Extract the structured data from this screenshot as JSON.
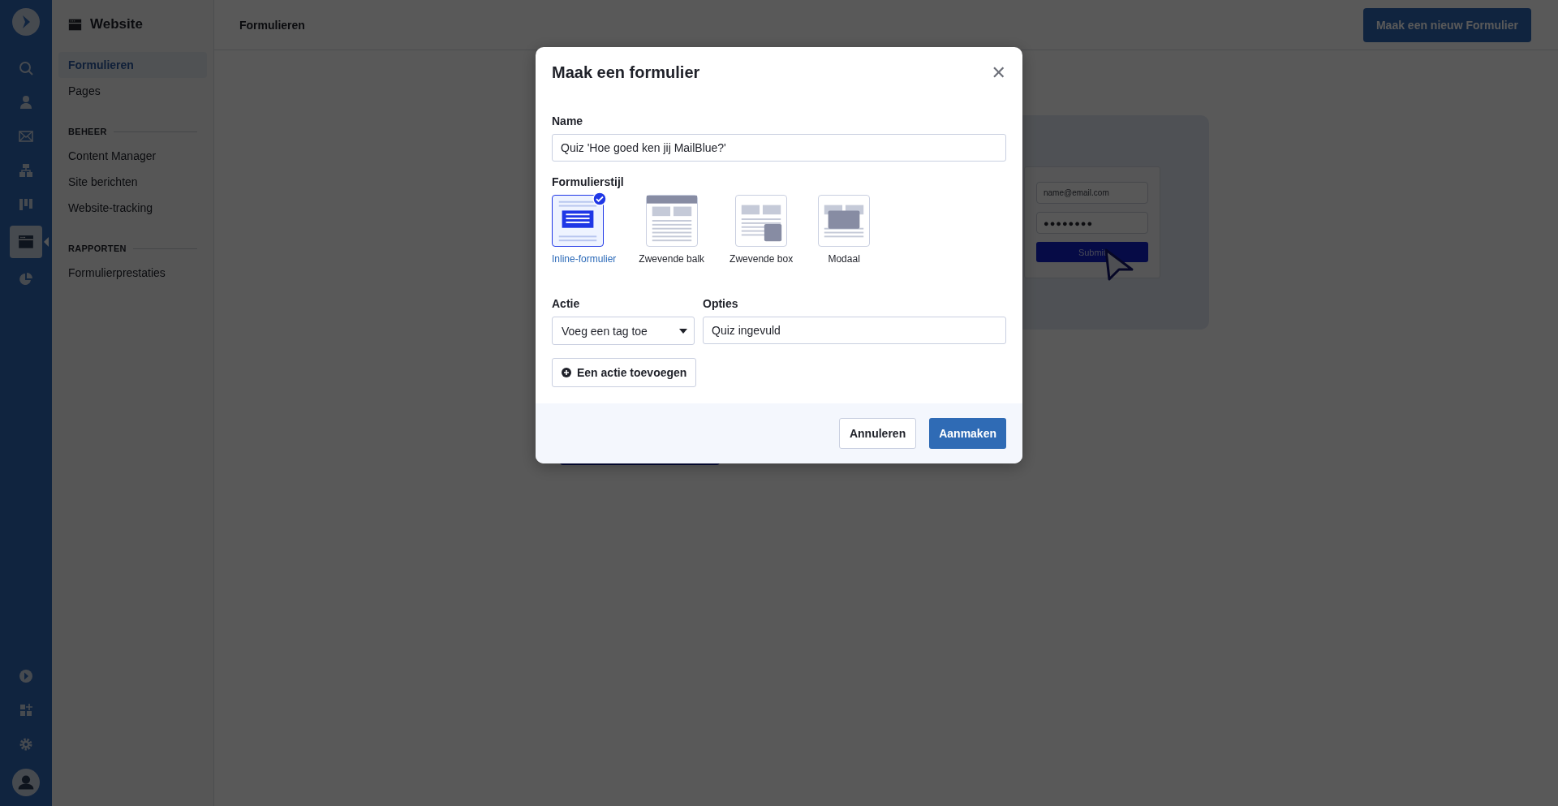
{
  "rail": {
    "items": [
      {
        "kind": "search",
        "selected": false
      },
      {
        "kind": "contacts",
        "selected": false
      },
      {
        "kind": "campaigns",
        "selected": false
      },
      {
        "kind": "automations",
        "selected": false
      },
      {
        "kind": "deals",
        "selected": false
      },
      {
        "kind": "website",
        "selected": true
      },
      {
        "kind": "reports",
        "selected": false
      }
    ],
    "bottom": [
      {
        "kind": "play"
      },
      {
        "kind": "apps"
      },
      {
        "kind": "settings"
      },
      {
        "kind": "avatar"
      }
    ]
  },
  "sidebar": {
    "title": "Website",
    "groups": [
      {
        "items": [
          {
            "label": "Formulieren",
            "selected": true
          },
          {
            "label": "Pages",
            "selected": false
          }
        ]
      },
      {
        "heading": "BEHEER",
        "items": [
          {
            "label": "Content Manager",
            "selected": false
          },
          {
            "label": "Site berichten",
            "selected": false
          },
          {
            "label": "Website-tracking",
            "selected": false
          }
        ]
      },
      {
        "heading": "RAPPORTEN",
        "items": [
          {
            "label": "Formulierprestaties",
            "selected": false
          }
        ]
      }
    ]
  },
  "header": {
    "title": "Formulieren",
    "button": "Maak een nieuw Formulier"
  },
  "illustration": {
    "email_placeholder": "name@email.com",
    "password": "●●●●●●●●",
    "submit": "Submit"
  },
  "modal": {
    "title": "Maak een formulier",
    "close": "✕",
    "name_label": "Name",
    "name_value": "Quiz 'Hoe goed ken jij MailBlue?'",
    "style_label": "Formulierstijl",
    "styles": [
      {
        "kind": "inline",
        "label": "Inline-formulier",
        "selected": true
      },
      {
        "kind": "bar",
        "label": "Zwevende balk",
        "selected": false
      },
      {
        "kind": "box",
        "label": "Zwevende box",
        "selected": false
      },
      {
        "kind": "modal",
        "label": "Modaal",
        "selected": false
      }
    ],
    "action_label": "Actie",
    "action_value": "Voeg een tag toe",
    "options_label": "Opties",
    "options_value": "Quiz ingevuld",
    "add_action": "Een actie toevoegen",
    "cancel": "Annuleren",
    "create": "Aanmaken"
  }
}
